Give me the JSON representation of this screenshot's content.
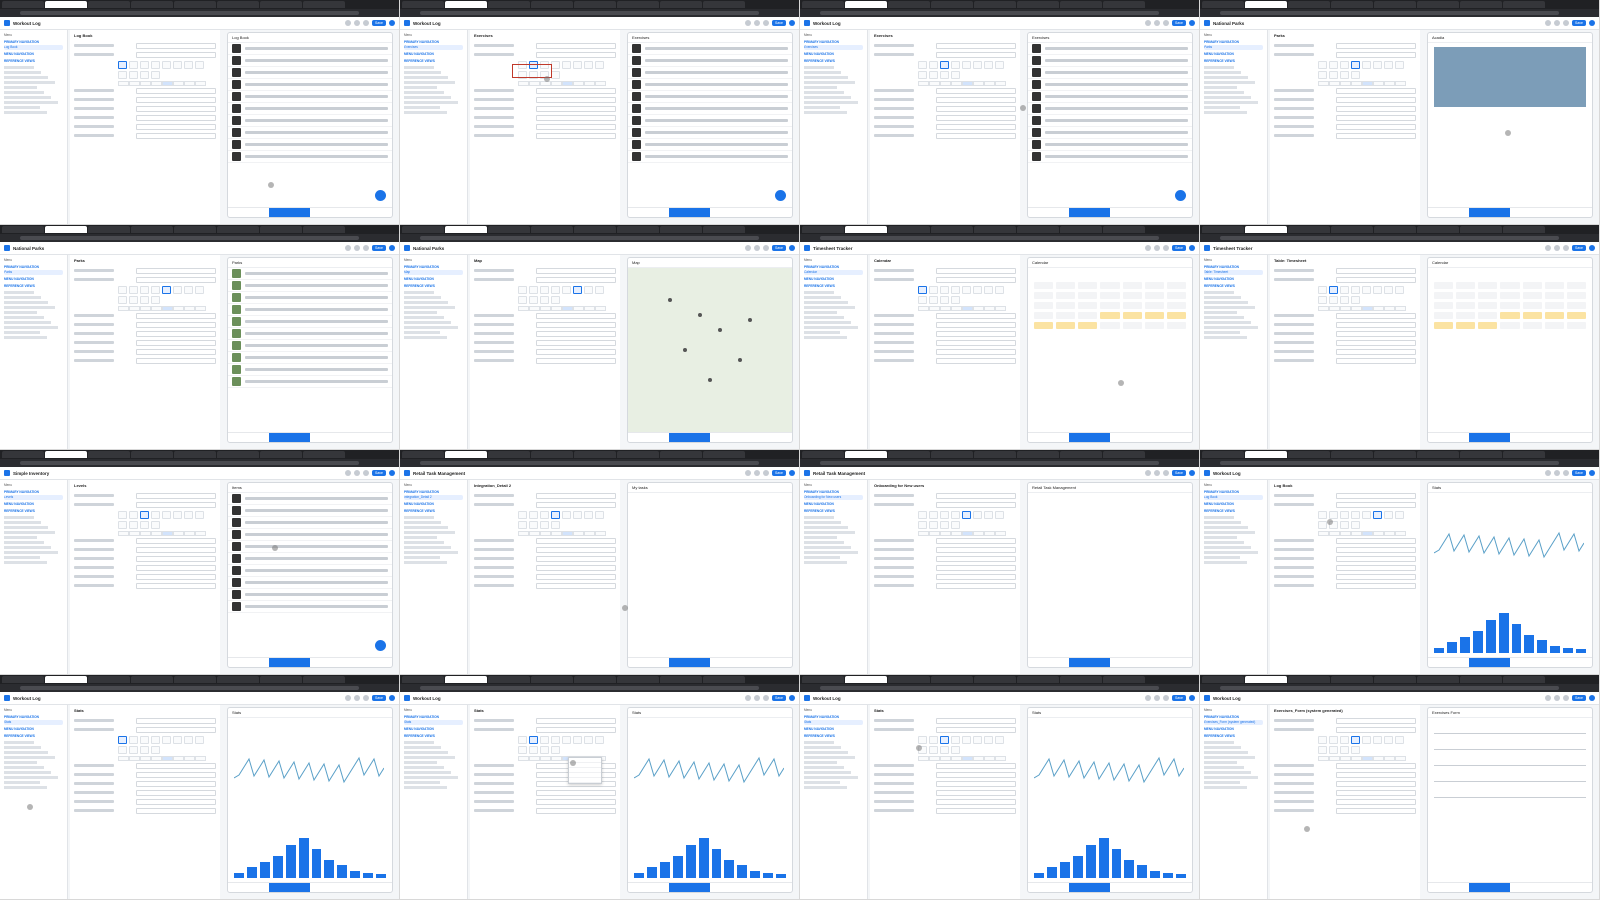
{
  "tiles": [
    {
      "app_title": "Workout Log",
      "view": "Log Book",
      "save": "Save",
      "preview": "Log Book"
    },
    {
      "app_title": "Workout Log",
      "view": "Exercises",
      "save": "Save",
      "preview": "Exercises"
    },
    {
      "app_title": "Workout Log",
      "view": "Exercises",
      "save": "Save",
      "preview": "Exercises"
    },
    {
      "app_title": "National Parks",
      "view": "Parks",
      "save": "Save",
      "preview": "Acadia"
    },
    {
      "app_title": "National Parks",
      "view": "Parks",
      "save": "Save",
      "preview": "Parks"
    },
    {
      "app_title": "National Parks",
      "view": "Map",
      "save": "Save",
      "preview": "Map"
    },
    {
      "app_title": "Timesheet Tracker",
      "view": "Calendar",
      "save": "Save",
      "preview": "Calendar"
    },
    {
      "app_title": "Timesheet Tracker",
      "view": "Table: Timesheet",
      "save": "Save",
      "preview": "Calendar"
    },
    {
      "app_title": "Simple Inventory",
      "view": "Levels",
      "save": "Save",
      "preview": "Items"
    },
    {
      "app_title": "Retail Task Management",
      "view": "Integration_Detail 2",
      "save": "Save",
      "preview": "My tasks"
    },
    {
      "app_title": "Retail Task Management",
      "view": "Onboarding for New users",
      "save": "Save",
      "preview": "Retail Task Management"
    },
    {
      "app_title": "Workout Log",
      "view": "Log Book",
      "save": "Save",
      "preview": "Stats"
    },
    {
      "app_title": "Workout Log",
      "view": "Stats",
      "save": "Save",
      "preview": "Stats"
    },
    {
      "app_title": "Workout Log",
      "view": "Stats",
      "save": "Save",
      "preview": "Stats"
    },
    {
      "app_title": "Workout Log",
      "view": "Stats",
      "save": "Save",
      "preview": "Stats"
    },
    {
      "app_title": "Workout Log",
      "view": "Exercises_Form (system generated)",
      "save": "Save",
      "preview": "Exercises Form"
    }
  ],
  "sidebar_common": {
    "menu": "Menu",
    "primary": "PRIMARY NAVIGATION",
    "menu_nav": "MENU NAVIGATION",
    "reference": "REFERENCE VIEWS"
  },
  "map_labels": {
    "tab_map": "Map",
    "tab_satellite": "Satellite"
  },
  "calendar": {
    "month": "November 2024",
    "today": "TODAY",
    "tabs": [
      "Day",
      "Week",
      "Month"
    ]
  },
  "parks_list": [
    "Acadia",
    "American Samoa",
    "Arches",
    "Badlands",
    "Big Bend",
    "Biscayne"
  ],
  "stats_cards": [
    "Overview",
    "Total Reps",
    "Set 1 Weights (lbs.)",
    "Calendar"
  ],
  "form_title": "Exercises Form",
  "form_buttons": {
    "cancel": "Cancel",
    "save": "Save"
  },
  "dropdown_options": [
    "Large",
    "Medium",
    "Small"
  ]
}
